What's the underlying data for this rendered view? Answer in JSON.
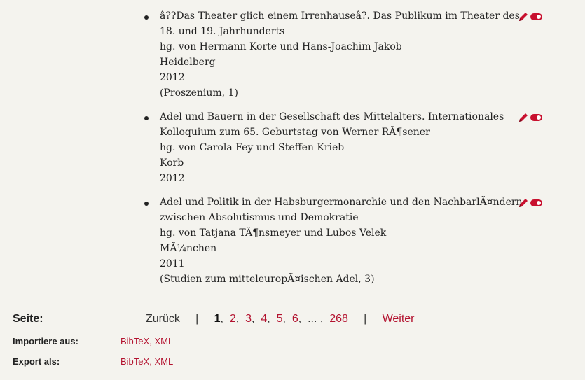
{
  "entries": [
    {
      "lines": [
        "â??Das Theater glich einem Irrenhauseâ?. Das Publikum im Theater des",
        "18. und 19. Jahrhunderts",
        "hg. von Hermann Korte und Hans-Joachim Jakob",
        "Heidelberg",
        "2012",
        "(Proszenium, 1)"
      ]
    },
    {
      "lines": [
        "Adel und Bauern in der Gesellschaft des Mittelalters. Internationales",
        "Kolloquium zum 65. Geburtstag von Werner RÃ¶sener",
        "hg. von Carola Fey und Steffen Krieb",
        "Korb",
        "2012"
      ]
    },
    {
      "lines": [
        "Adel und Politik in der Habsburgermonarchie und den NachbarlÃ¤ndern",
        "zwischen Absolutismus und Demokratie",
        "hg. von Tatjana TÃ¶nsmeyer und Lubos Velek",
        "MÃ¼nchen",
        "2011",
        "(Studien zum mitteleuropÃ¤ischen Adel, 3)"
      ]
    }
  ],
  "pagination": {
    "label": "Seite:",
    "back": "Zurück",
    "separator": "|",
    "current": "1",
    "pages": [
      "2",
      "3",
      "4",
      "5",
      "6"
    ],
    "ellipsis": "...",
    "last": "268",
    "next": "Weiter"
  },
  "import": {
    "label": "Importiere aus:",
    "formats": [
      "BibTeX",
      "XML"
    ]
  },
  "export": {
    "label": "Export als:",
    "formats": [
      "BibTeX",
      "XML"
    ]
  },
  "icons": {
    "edit": "pencil-icon",
    "toggle": "toggle-icon"
  },
  "colors": {
    "accent": "#c8102e",
    "link": "#b3122f",
    "background": "#f4f3ee"
  }
}
